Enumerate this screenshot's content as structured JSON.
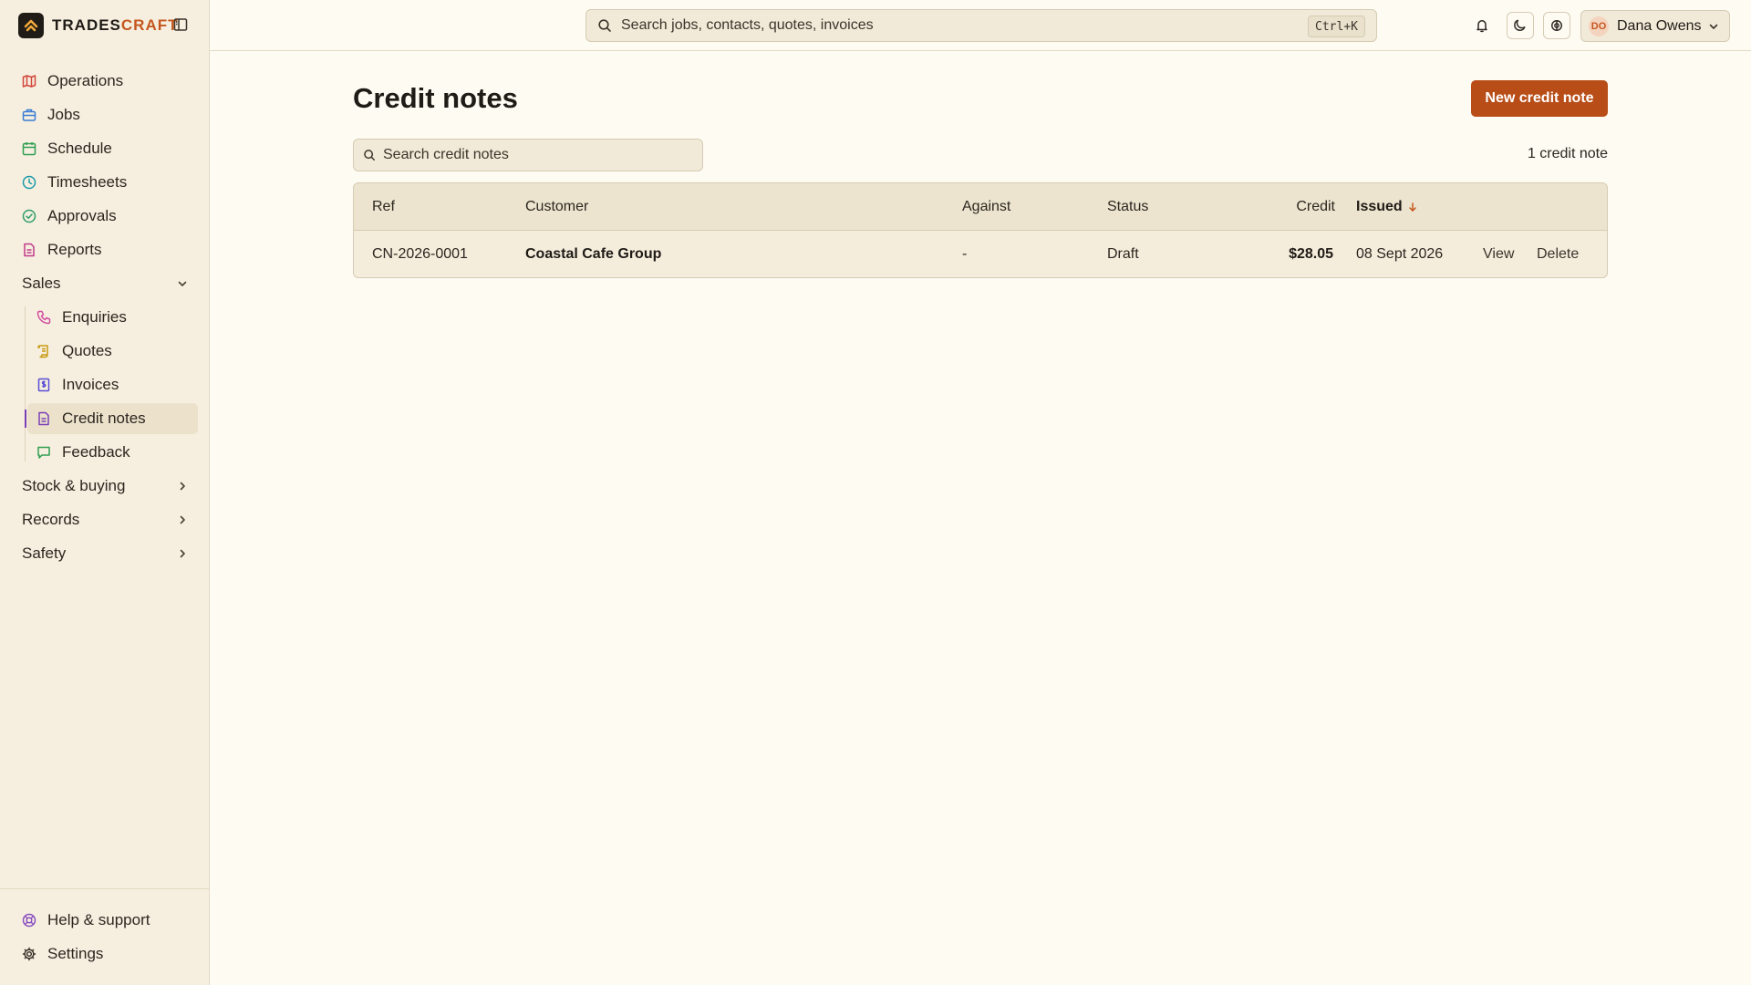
{
  "brand": {
    "name_part1": "TRADES",
    "name_part2": "CRAFT"
  },
  "sidebar": {
    "items": [
      {
        "label": "Operations"
      },
      {
        "label": "Jobs"
      },
      {
        "label": "Schedule"
      },
      {
        "label": "Timesheets"
      },
      {
        "label": "Approvals"
      },
      {
        "label": "Reports"
      }
    ],
    "sales_group": {
      "label": "Sales"
    },
    "sales_items": [
      {
        "label": "Enquiries"
      },
      {
        "label": "Quotes"
      },
      {
        "label": "Invoices"
      },
      {
        "label": "Credit notes"
      },
      {
        "label": "Feedback"
      }
    ],
    "collapsed_groups": [
      {
        "label": "Stock & buying"
      },
      {
        "label": "Records"
      },
      {
        "label": "Safety"
      }
    ],
    "bottom": [
      {
        "label": "Help & support"
      },
      {
        "label": "Settings"
      }
    ]
  },
  "topbar": {
    "search_placeholder": "Search jobs, contacts, quotes, invoices",
    "shortcut": "Ctrl+K",
    "user": {
      "initials": "DO",
      "name": "Dana Owens"
    }
  },
  "main": {
    "title": "Credit notes",
    "new_button": "New credit note",
    "search_placeholder": "Search credit notes",
    "count_label": "1 credit note",
    "table": {
      "headers": {
        "ref": "Ref",
        "customer": "Customer",
        "against": "Against",
        "status": "Status",
        "credit": "Credit",
        "issued": "Issued"
      },
      "rows": [
        {
          "ref": "CN-2026-0001",
          "customer": "Coastal Cafe Group",
          "against": "-",
          "status": "Draft",
          "credit": "$28.05",
          "issued": "08 Sept 2026",
          "view": "View",
          "delete": "Delete"
        }
      ]
    }
  },
  "colors": {
    "accent": "#b84d17",
    "active_indicator": "#7b3fb5",
    "sidebar_bg": "#f6efdf",
    "page_bg": "#fefbf3"
  }
}
